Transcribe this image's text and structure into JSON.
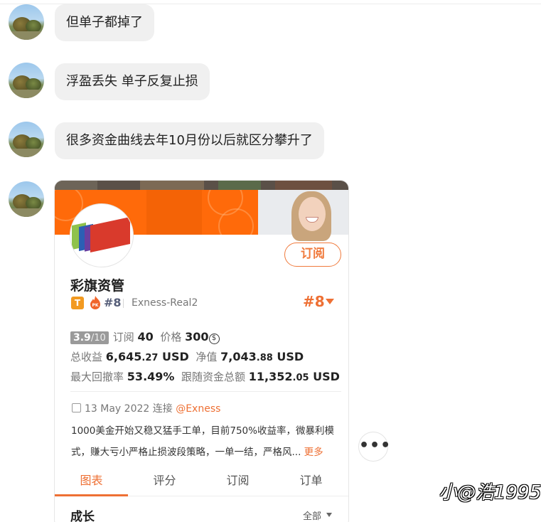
{
  "messages": [
    {
      "text": "但单子都掉了"
    },
    {
      "text": "浮盈丢失 单子反复止损"
    },
    {
      "text": "很多资金曲线去年10月份以后就区分攀升了"
    }
  ],
  "card": {
    "subscribe_label": "订阅",
    "name": "彩旗资管",
    "badge_letter": "T",
    "pk_label": "PK",
    "rank_small": "#8",
    "account": "Exness-Real2",
    "rank_big": "#8",
    "score_value": "3.9",
    "score_max": "/10",
    "subs_label": "订阅",
    "subs_value": "40",
    "price_label": "价格",
    "price_value": "300",
    "coin_symbol": "$",
    "total_profit_label": "总收益",
    "total_profit_int": "6,645",
    "total_profit_dec": ".27",
    "total_profit_unit": "USD",
    "net_value_label": "净值",
    "net_value_int": "7,043",
    "net_value_dec": ".88",
    "net_value_unit": "USD",
    "max_drawdown_label": "最大回撤率",
    "max_drawdown_value": "53.49%",
    "follow_total_label": "跟随资金总额",
    "follow_total_int": "11,352",
    "follow_total_dec": ".05",
    "follow_total_unit": "USD",
    "date": "13 May 2022",
    "connect_label": "连接",
    "broker": "@Exness",
    "description_line1": "1000美金开始又稳又猛手工单，目前750%收益率，微暴利模",
    "description_line2": "式，赚大亏小严格止损波段策略，一单一结，严格风...",
    "more_label": "更多",
    "tabs": [
      {
        "label": "图表"
      },
      {
        "label": "评分"
      },
      {
        "label": "订阅"
      },
      {
        "label": "订单"
      }
    ],
    "growth_label": "成长",
    "range_label": "全部"
  },
  "more_button_label": "•••",
  "watermark": "小@浩1995",
  "colors": {
    "accent": "#ee7034",
    "banner_orange": "#ff6a0a",
    "bubble_bg": "#f0f0f0"
  },
  "icons": {
    "avatar": "landscape-avatar",
    "calendar": "calendar-icon",
    "dropdown": "caret-down-icon",
    "rank_badge": "fire-pk-icon"
  }
}
